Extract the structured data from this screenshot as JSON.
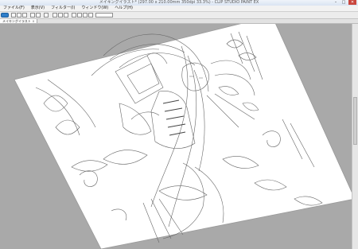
{
  "window": {
    "title": "メイキングイラスト* (297.00 x 210.00mm 350dpi 33.3%) - CLIP STUDIO PAINT EX",
    "minimize": "–",
    "maximize": "□",
    "close": "✕"
  },
  "menu": [
    {
      "label": "ファイル(F)"
    },
    {
      "label": "表示(V)"
    },
    {
      "label": "フィルター(I)"
    },
    {
      "label": "ウィンドウ(W)"
    },
    {
      "label": "ヘルプ(H)"
    }
  ],
  "toolbar": {
    "icons": [
      "clip-logo-icon",
      "new-file-icon",
      "open-icon",
      "save-icon",
      "undo-icon",
      "redo-icon",
      "transform-icon",
      "pen-icon",
      "eraser-icon",
      "brush-icon",
      "selection-icon",
      "grid-icon",
      "ruler-icon",
      "layer-icon",
      "dropdown-icon"
    ]
  },
  "document_tab": {
    "label": "メイキングイラスト",
    "close": "x"
  },
  "colors": {
    "canvas_background": "#a9a9a9",
    "paper": "#ffffff",
    "line_art": "#555555"
  }
}
